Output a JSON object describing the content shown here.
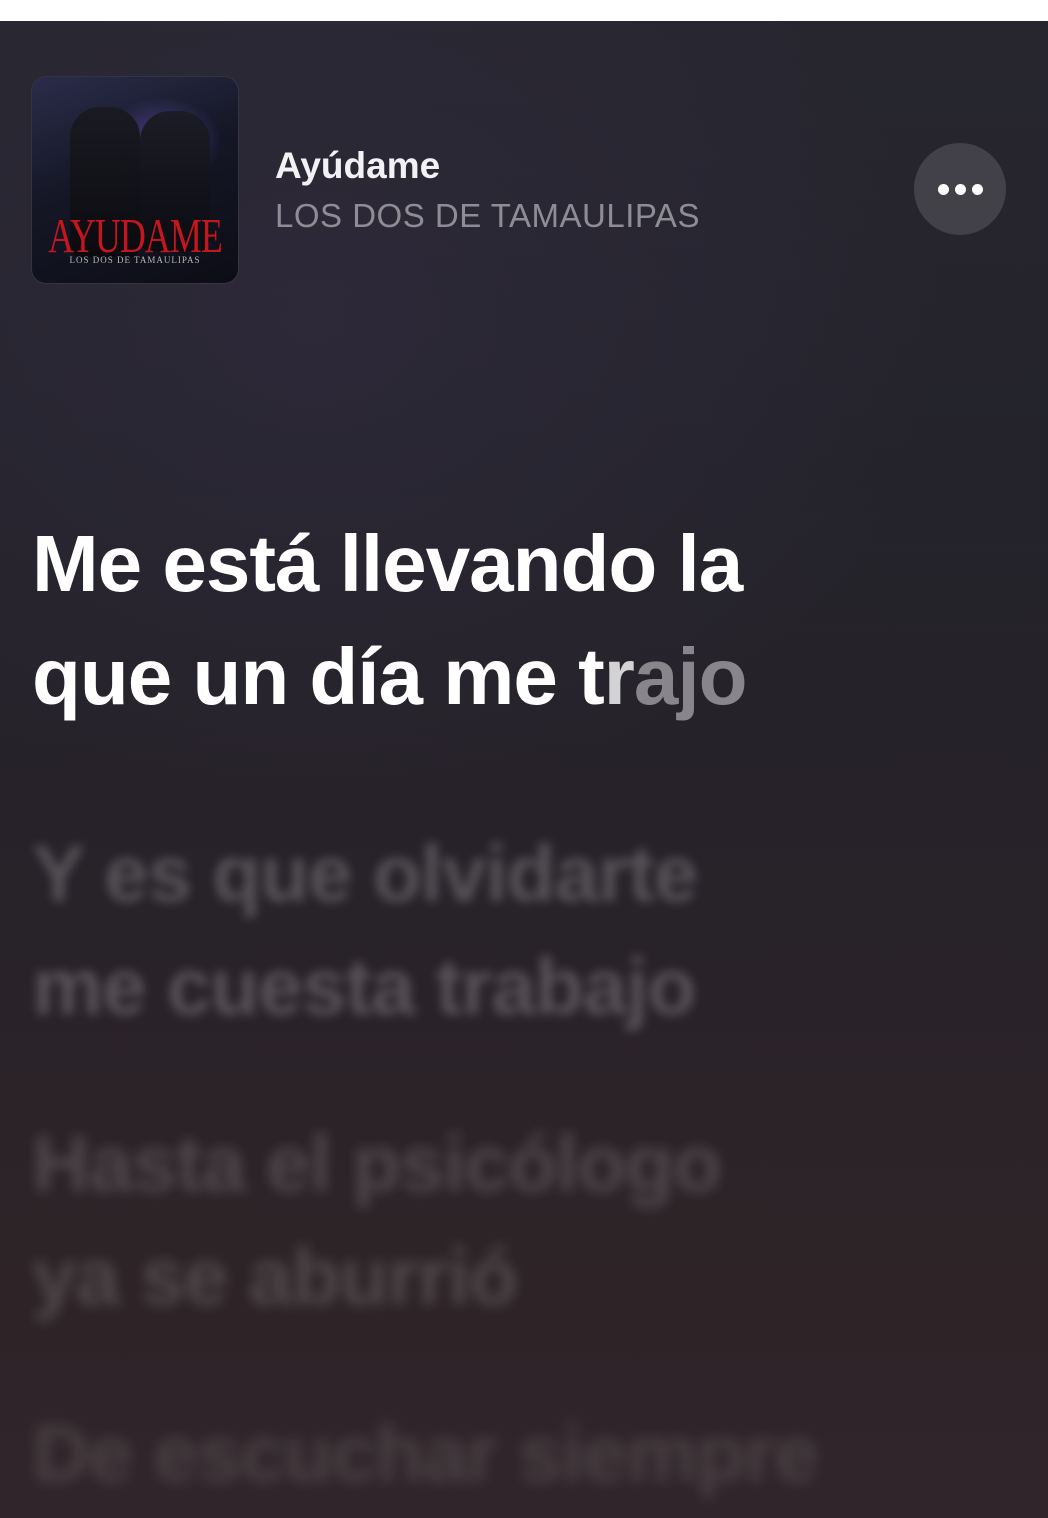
{
  "now_playing": {
    "title": "Ayúdame",
    "artist": "LOS DOS DE TAMAULIPAS",
    "album_art": {
      "title_text": "AYUDAME",
      "subtitle_text": "LOS DOS DE TAMAULIPAS",
      "accent_color": "#c3161d"
    },
    "more_button_icon": "ellipsis-icon"
  },
  "lyrics": {
    "active": {
      "line1": "Me está llevando la",
      "line2_sung": "que un día me t",
      "line2_partial": "r",
      "line2_unsung": "ajo"
    },
    "upcoming": [
      {
        "line1": "Y es que olvidarte",
        "line2": "me cuesta trabajo"
      },
      {
        "line1": "Hasta el psicólogo",
        "line2": "ya se aburrió"
      },
      {
        "line1": "De escuchar siempre",
        "line2": ""
      }
    ]
  },
  "colors": {
    "background": "#26252d",
    "active_lyric": "#ffffff",
    "artist_text": "#8e8c94"
  }
}
